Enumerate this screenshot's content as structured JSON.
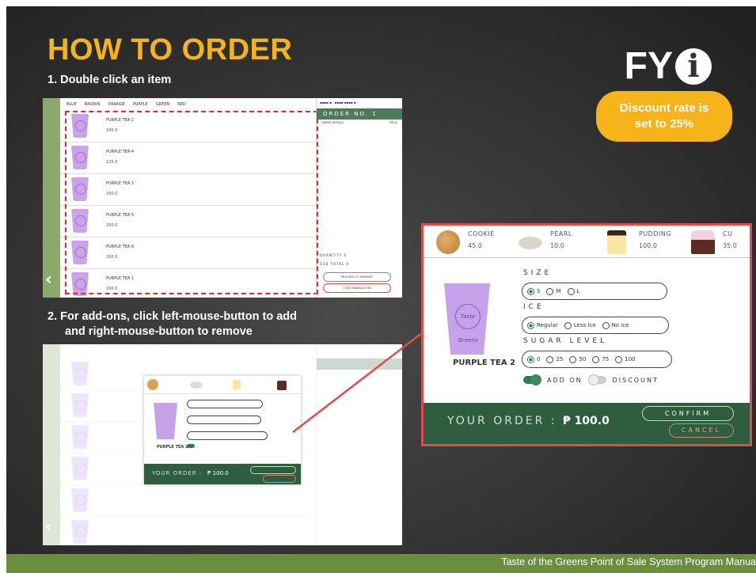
{
  "slide": {
    "title": "HOW TO ORDER",
    "step1": "1. Double click an item",
    "step2_line1": "2. For add-ons, click left-mouse-button to add",
    "step2_line2": "and right-mouse-button to remove",
    "fyi_text": "FY",
    "fyi_icon": "i",
    "badge_line1": "Discount rate is",
    "badge_line2": "set to 25%",
    "footer": "Taste of the Greens Point of Sale System Program Manua"
  },
  "colors": {
    "title": "#f6b31a",
    "badge": "#f6b31a",
    "footer": "#6b8e3e",
    "highlight_border": "#e24b4b",
    "order_bar": "#2e5d3f"
  },
  "pos": {
    "categories": [
      "BLUE",
      "BROWN",
      "ORANGE",
      "PURPLE",
      "GREEN",
      "RED"
    ],
    "items": [
      {
        "name": "PURPLE TEA 2",
        "price": "100.0"
      },
      {
        "name": "PURPLE TEA 4",
        "price": "125.0"
      },
      {
        "name": "PURPLE TEA 3",
        "price": "100.0"
      },
      {
        "name": "PURPLE TEA 5",
        "price": "100.0"
      },
      {
        "name": "PURPLE TEA 6",
        "price": "100.0"
      },
      {
        "name": "PURPLE TEA 1",
        "price": "100.0"
      }
    ],
    "order_header": "ORDER NO. 1",
    "order_details_col": "ORDER DETAILS",
    "price_col": "PRICE",
    "quantity_label": "QUANTITY 0",
    "subtotal_label": "SUB TOTAL 0",
    "proceed_button": "PROCEED TO PAYMENT",
    "void_button": "VOID TRANSACTION"
  },
  "dialog": {
    "addons": [
      {
        "name": "COOKIE",
        "price": "45.0",
        "icon": "cookie-icon"
      },
      {
        "name": "PEARL",
        "price": "10.0",
        "icon": "pearl-icon"
      },
      {
        "name": "PUDDING",
        "price": "100.0",
        "icon": "pudding-icon"
      },
      {
        "name": "CU",
        "price": "35.0",
        "icon": "cupcake-icon"
      }
    ],
    "product_name": "PURPLE TEA 2",
    "cup_logo": "Taste Greens",
    "size_label": "SIZE",
    "size_options": [
      "S",
      "M",
      "L"
    ],
    "ice_label": "ICE",
    "ice_options": [
      "Regular",
      "Less ice",
      "No ice"
    ],
    "sugar_label": "SUGAR LEVEL",
    "sugar_options": [
      "0",
      "25",
      "50",
      "75",
      "100"
    ],
    "addon_toggle": "ADD ON",
    "discount_toggle": "DISCOUNT",
    "your_order_label": "YOUR ORDER :",
    "your_order_value": "₱ 100.0",
    "confirm_button": "CONFIRM",
    "cancel_button": "CANCEL"
  }
}
